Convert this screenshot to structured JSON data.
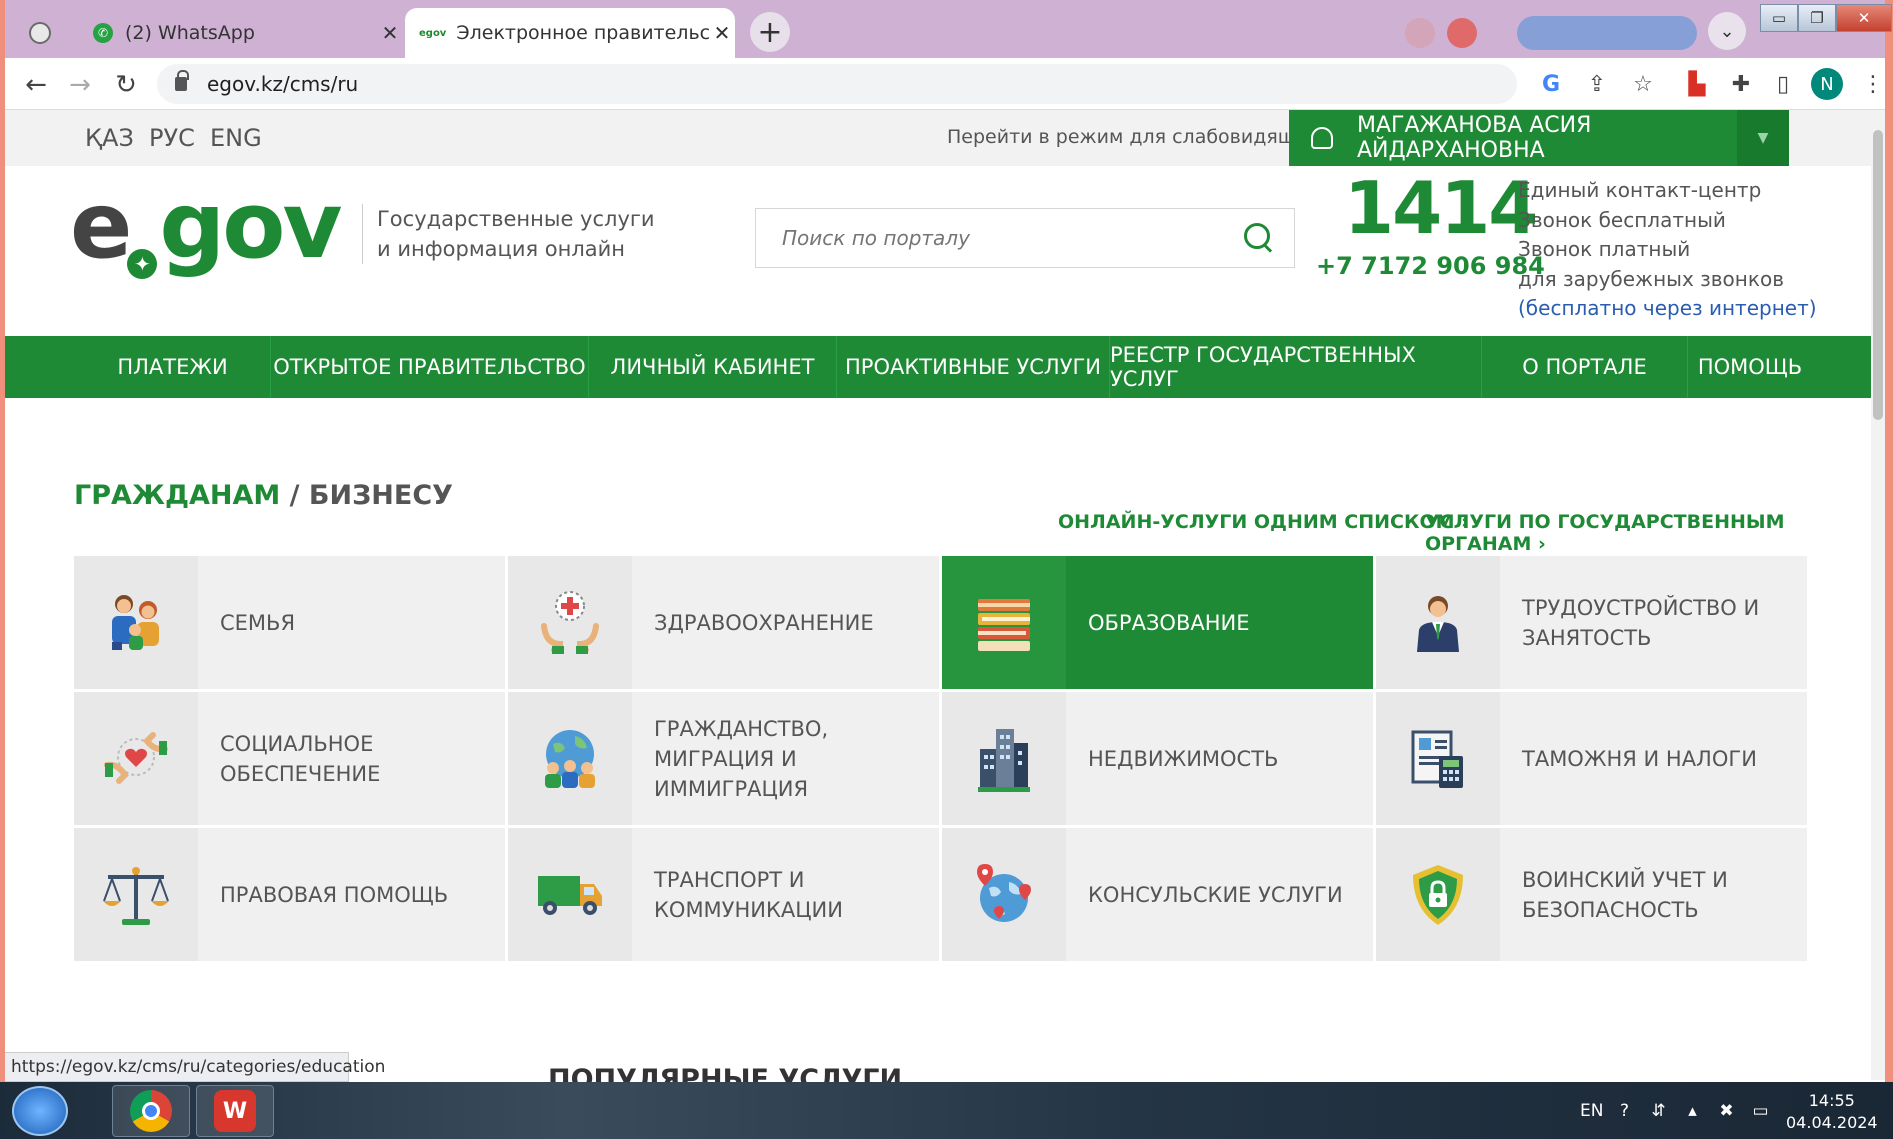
{
  "browser": {
    "tabs": [
      {
        "title": "(2) WhatsApp",
        "active": false
      },
      {
        "title": "Электронное правительство Ре",
        "active": true
      }
    ],
    "url": "egov.kz/cms/ru",
    "profile_initial": "N",
    "accent_color": "#1f8a35"
  },
  "top_strip": {
    "languages": [
      "ҚАЗ",
      "РУС",
      "ENG"
    ],
    "accessibility_link": "Перейти в режим для слабовидящих",
    "user_name": "МАГАЖАНОВА АСИЯ АЙДАРХАНОВНА"
  },
  "header": {
    "logo": "egov",
    "tagline_line1": "Государственные услуги",
    "tagline_line2": "и информация онлайн",
    "search_placeholder": "Поиск по порталу",
    "hotline_number": "1414",
    "hotline_phone": "+7 7172 906 984",
    "contact_lines": [
      "Единый контакт-центр",
      "Звонок бесплатный",
      "Звонок платный",
      "для зарубежных звонков"
    ],
    "contact_link": "(бесплатно через интернет)"
  },
  "main_nav": [
    "ПЛАТЕЖИ",
    "ОТКРЫТОЕ ПРАВИТЕЛЬСТВО",
    "ЛИЧНЫЙ КАБИНЕТ",
    "ПРОАКТИВНЫЕ УСЛУГИ",
    "РЕЕСТР ГОСУДАРСТВЕННЫХ УСЛУГ",
    "О ПОРТАЛЕ",
    "ПОМОЩЬ"
  ],
  "section": {
    "title_citizens": "ГРАЖДАНАМ",
    "title_separator": " / ",
    "title_business": "БИЗНЕСУ",
    "link_all_services": "ОНЛАЙН-УСЛУГИ ОДНИМ СПИСКОМ ›",
    "link_by_agency": "УСЛУГИ ПО ГОСУДАРСТВЕННЫМ ОРГАНАМ ›"
  },
  "categories": [
    {
      "label": "СЕМЬЯ",
      "icon": "family-icon",
      "active": false
    },
    {
      "label": "ЗДРАВООХРАНЕНИЕ",
      "icon": "healthcare-icon",
      "active": false
    },
    {
      "label": "ОБРАЗОВАНИЕ",
      "icon": "books-icon",
      "active": true
    },
    {
      "label": "ТРУДОУСТРОЙСТВО И ЗАНЯТОСТЬ",
      "icon": "employee-icon",
      "active": false
    },
    {
      "label": "СОЦИАЛЬНОЕ ОБЕСПЕЧЕНИЕ",
      "icon": "heart-hands-icon",
      "active": false
    },
    {
      "label": "ГРАЖДАНСТВО, МИГРАЦИЯ И ИММИГРАЦИЯ",
      "icon": "globe-people-icon",
      "active": false
    },
    {
      "label": "НЕДВИЖИМОСТЬ",
      "icon": "buildings-icon",
      "active": false
    },
    {
      "label": "ТАМОЖНЯ И НАЛОГИ",
      "icon": "tax-document-icon",
      "active": false
    },
    {
      "label": "ПРАВОВАЯ ПОМОЩЬ",
      "icon": "scales-icon",
      "active": false
    },
    {
      "label": "ТРАНСПОРТ И КОММУНИКАЦИИ",
      "icon": "truck-icon",
      "active": false
    },
    {
      "label": "КОНСУЛЬСКИЕ УСЛУГИ",
      "icon": "globe-pins-icon",
      "active": false
    },
    {
      "label": "ВОИНСКИЙ УЧЕТ И БЕЗОПАСНОСТЬ",
      "icon": "shield-lock-icon",
      "active": false
    }
  ],
  "popular_heading": "ПОПУЛЯРНЫЕ УСЛУГИ",
  "status_url": "https://egov.kz/cms/ru/categories/education",
  "taskbar": {
    "language": "EN",
    "time": "14:55",
    "date": "04.04.2024"
  }
}
